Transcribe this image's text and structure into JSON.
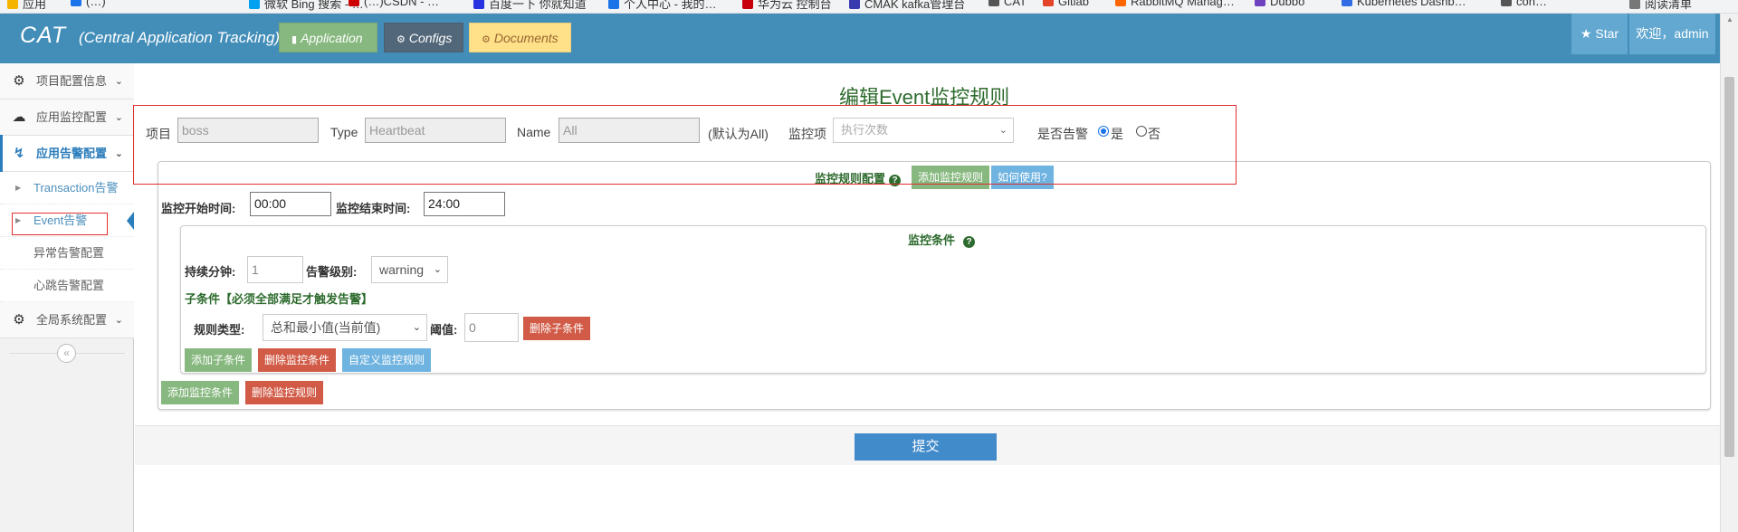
{
  "bookmarks": [
    "应用",
    "(…)",
    "微软 Bing 搜索 - …",
    "(…)CSDN - …",
    "百度一下 你就知道",
    "个人中心 - 我的…",
    "华为云 控制台",
    "CMAK kafka管理台",
    "CAT",
    "Gitlab",
    "RabbitMQ Manag…",
    "Dubbo",
    "Kubernetes Dashb…",
    "con…",
    "阅读清单"
  ],
  "navbar": {
    "brand": "CAT",
    "brand_sub": "(Central Application Tracking)",
    "buttons": {
      "application": "Application",
      "configs": "Configs",
      "documents": "Documents"
    },
    "star": "Star",
    "welcome": "欢迎，admin"
  },
  "sidebar": {
    "items": [
      {
        "label": "项目配置信息",
        "icon": "gears-icon"
      },
      {
        "label": "应用监控配置",
        "icon": "cloud-icon"
      },
      {
        "label": "应用告警配置",
        "icon": "bolt-icon"
      },
      {
        "label": "全局系统配置",
        "icon": "gear-icon"
      }
    ],
    "subitems": [
      {
        "label": "Transaction告警"
      },
      {
        "label": "Event告警"
      },
      {
        "label": "异常告警配置"
      },
      {
        "label": "心跳告警配置"
      }
    ],
    "collapse_glyph": "«"
  },
  "main": {
    "title": "编辑Event监控规则",
    "filter": {
      "project_label": "项目",
      "project_value": "boss",
      "type_label": "Type",
      "type_value": "Heartbeat",
      "name_label": "Name",
      "name_value": "All",
      "name_hint": "(默认为All)",
      "metric_label": "监控项",
      "metric_value": "执行次数",
      "alert_label": "是否告警",
      "alert_yes": "是",
      "alert_no": "否",
      "alert_selected": "是"
    },
    "rule_panel": {
      "title": "监控规则配置",
      "add_rule": "添加监控规则",
      "how_to": "如何使用?",
      "start_label": "监控开始时间:",
      "start_value": "00:00",
      "end_label": "监控结束时间:",
      "end_value": "24:00"
    },
    "condition_panel": {
      "title": "监控条件",
      "duration_label": "持续分钟:",
      "duration_value": "1",
      "level_label": "告警级别:",
      "level_value": "warning",
      "subcondition_title": "子条件【必须全部满足才触发告警】",
      "rule_type_label": "规则类型:",
      "rule_type_value": "总和最小值(当前值)",
      "threshold_label": "阈值:",
      "threshold_value": "0",
      "delete_sub": "删除子条件",
      "add_sub": "添加子条件",
      "delete_condition": "删除监控条件",
      "custom_rule": "自定义监控规则"
    },
    "add_condition": "添加监控条件",
    "delete_rule": "删除监控规则",
    "submit": "提交"
  },
  "colors": {
    "navbar": "#438eb9",
    "application_btn": "#87b87f",
    "configs_btn": "#52677a",
    "documents_btn": "#fee188",
    "accent": "#2b7dbc",
    "danger": "#d15b47",
    "info": "#6fb3e0",
    "title_green": "#2e6b2e",
    "submit": "#428bca"
  }
}
